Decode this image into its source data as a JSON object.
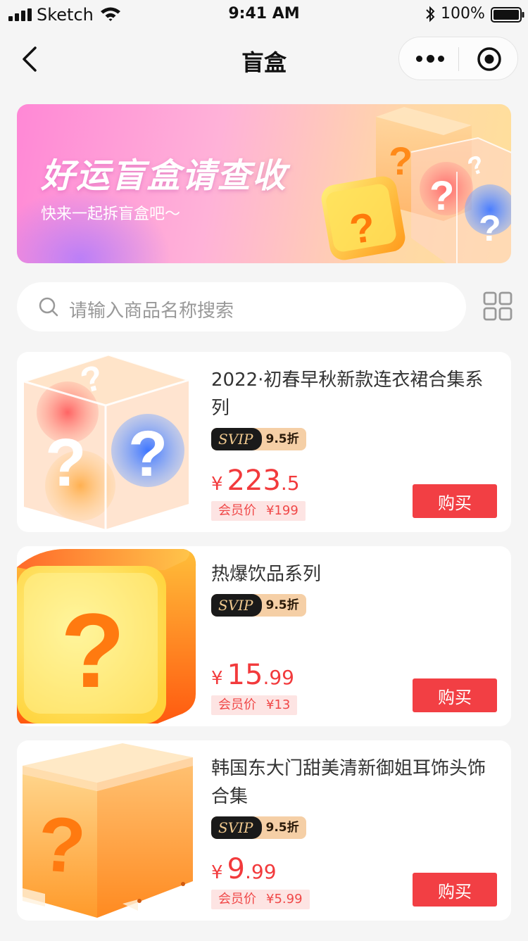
{
  "status_bar": {
    "carrier": "Sketch",
    "time": "9:41 AM",
    "battery": "100%"
  },
  "nav": {
    "title": "盲盒",
    "icons": [
      "back-icon",
      "more-icon",
      "target-icon"
    ]
  },
  "banner": {
    "title": "好运盲盒请查收",
    "subtitle": "快来一起拆盲盒吧～"
  },
  "search": {
    "placeholder": "请输入商品名称搜索"
  },
  "products": [
    {
      "title": "2022·初春早秋新款连衣裙合集系列",
      "svip_label": "SVIP",
      "discount": "9.5折",
      "currency": "¥",
      "price_int": "223",
      "price_dec": ".5",
      "member_label": "会员价",
      "member_price": "¥199",
      "buy_label": "购买"
    },
    {
      "title": "热爆饮品系列",
      "svip_label": "SVIP",
      "discount": "9.5折",
      "currency": "¥",
      "price_int": "15",
      "price_dec": ".99",
      "member_label": "会员价",
      "member_price": "¥13",
      "buy_label": "购买"
    },
    {
      "title": "韩国东大门甜美清新御姐耳饰头饰合集",
      "svip_label": "SVIP",
      "discount": "9.5折",
      "currency": "¥",
      "price_int": "9",
      "price_dec": ".99",
      "member_label": "会员价",
      "member_price": "¥5.99",
      "buy_label": "购买"
    }
  ],
  "colors": {
    "price_red": "#f23a3c",
    "buy_button": "#f23f44",
    "page_bg": "#f5f5f5",
    "svip_dark": "#1a1a1a",
    "svip_gold": "#f5cfa6"
  }
}
